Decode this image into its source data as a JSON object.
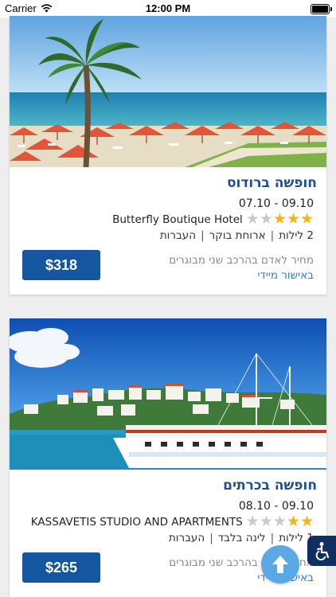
{
  "status_bar": {
    "carrier": "Carrier",
    "time": "12:00 PM"
  },
  "deals": [
    {
      "title": "חופשה ברודוס",
      "dates": "07.10 - 09.10",
      "stars": 3,
      "hotel": "Butterfly Boutique Hotel",
      "nights_label": "2 לילות",
      "board": "ארוחת בוקר",
      "transfers": "העברות",
      "price_note": "מחיר לאדם בהרכב שני מבוגרים",
      "approval": "באישור מיידי",
      "price": "$318"
    },
    {
      "title": "חופשה בכרתים",
      "dates": "08.10 - 09.10",
      "stars": 2,
      "hotel": "KASSAVETIS STUDIO AND APARTMENTS",
      "nights_label": "1 לילות",
      "board": "לינה בלבד",
      "transfers": "העברות",
      "price_note": "מחיר לאדם בהרכב שני מבוגרים",
      "approval": "באישור מיידי",
      "price": "$265"
    }
  ],
  "colors": {
    "title": "#1b4f8e",
    "price_button": "#1457a0",
    "link": "#2a7fd4",
    "star": "#f3b41b"
  },
  "icons": {
    "scroll_top": "arrow-up-icon",
    "accessibility": "accessibility-icon",
    "wifi": "wifi-icon"
  }
}
